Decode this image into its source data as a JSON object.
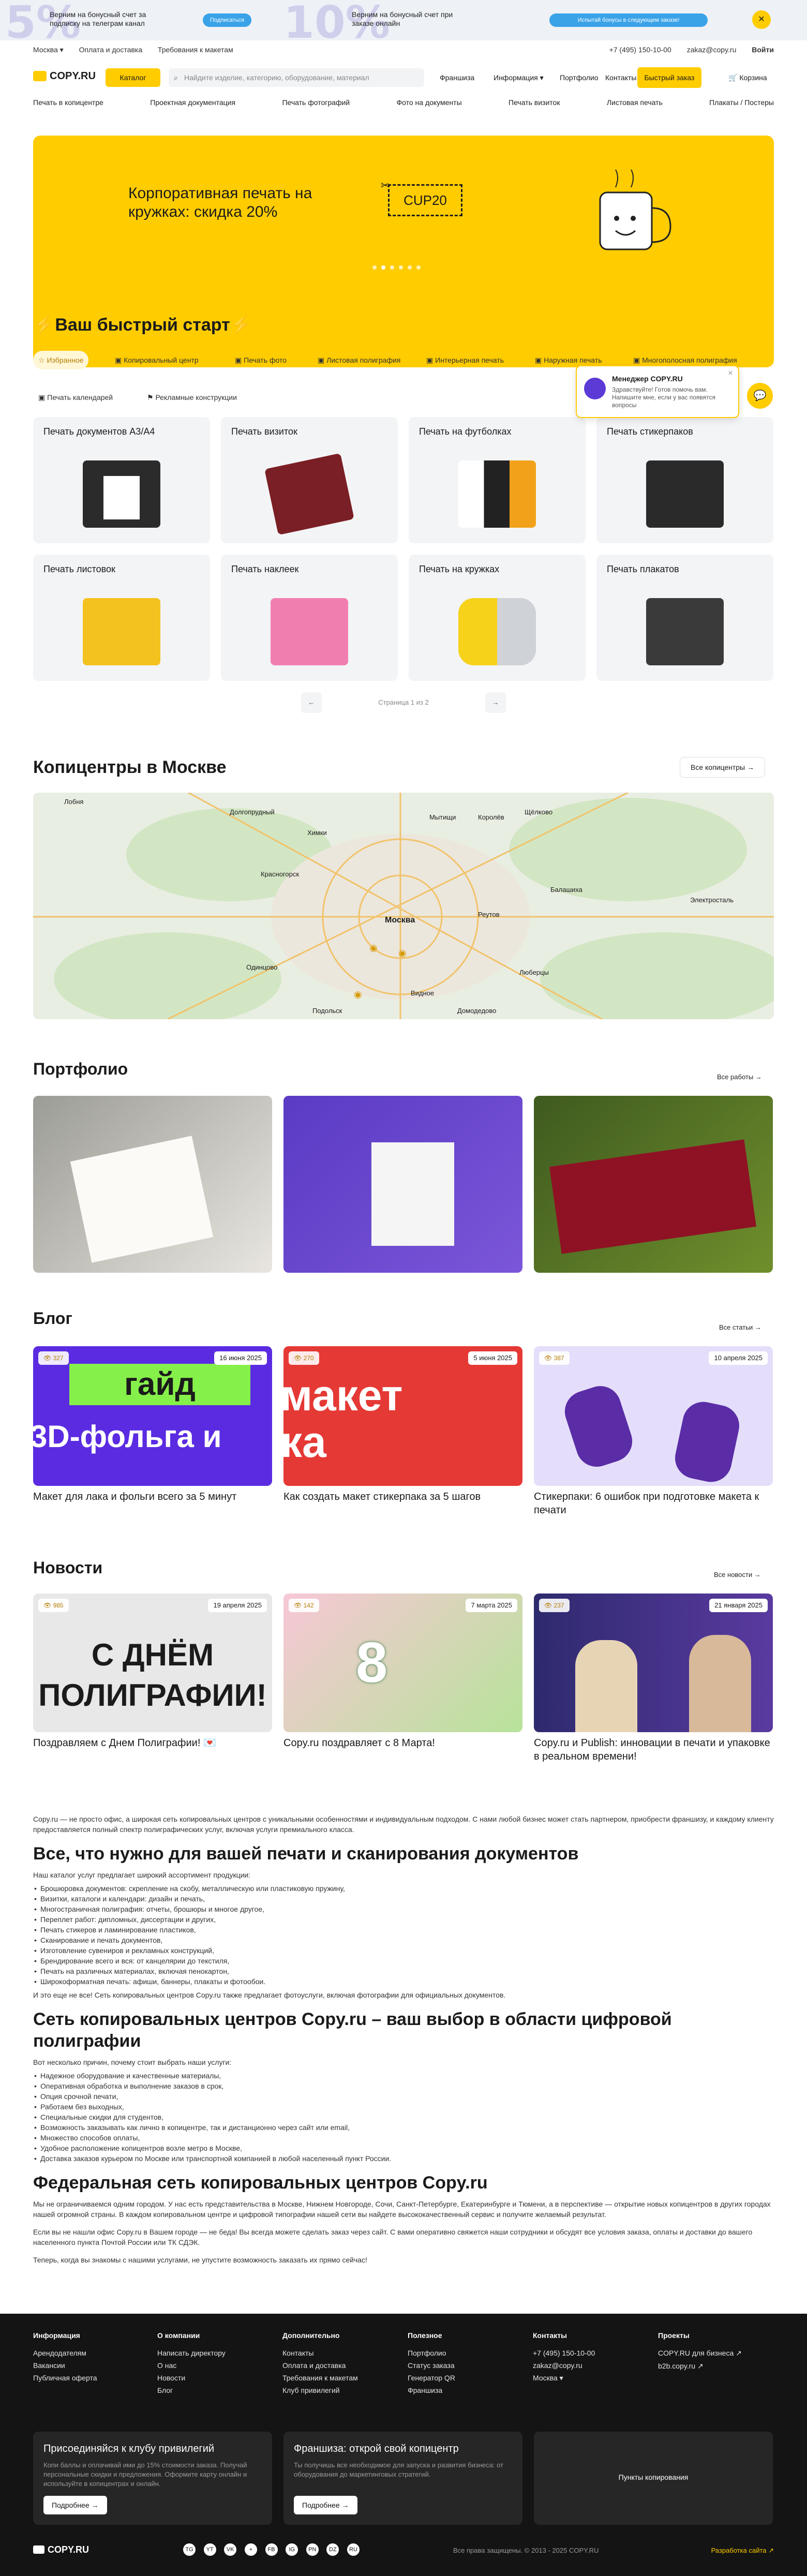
{
  "promo": {
    "left_text": "Верним на бонусный счет за подписку на телеграм канал",
    "left_button": "Подписаться",
    "right_text": "Верним на бонусный счет при заказе онлайн",
    "right_button": "Испытай бонусы в следующем заказе!",
    "num_left": "5%",
    "num_right": "10%",
    "close": "✕"
  },
  "topbar": {
    "city": "Москва ▾",
    "delivery": "Оплата и доставка",
    "requirements": "Требования к макетам",
    "phone": "+7 (495) 150-10-00",
    "email": "zakaz@copy.ru",
    "login": "Войти"
  },
  "header": {
    "logo": "COPY.RU",
    "catalog": "Каталог",
    "search_placeholder": "Найдите изделие, категорию, оборудование, материал",
    "nav": [
      "Франшиза",
      "Информация ▾",
      "Портфолио",
      "Контакты"
    ],
    "fast_order": "Быстрый заказ",
    "cart": "Корзина"
  },
  "categories": [
    "Печать в копицентре",
    "Проектная документация",
    "Печать фотографий",
    "Фото на документы",
    "Печать визиток",
    "Листовая печать",
    "Плакаты / Постеры"
  ],
  "banner": {
    "title": "Корпоративная печать на кружках: скидка 20%",
    "coupon": "CUP20"
  },
  "quickstart": {
    "title": "⚡Ваш быстрый старт⚡",
    "tabs": [
      "Избранное",
      "Копировальный центр",
      "Печать фото",
      "Листовая полиграфия",
      "Интерьерная печать",
      "Наружная печать",
      "Многополосная полиграфия",
      "Печать календарей",
      "Рекламные конструкции"
    ],
    "cards": [
      "Печать документов А3/А4",
      "Печать визиток",
      "Печать на футболках",
      "Печать стикерпаков",
      "Печать листовок",
      "Печать наклеек",
      "Печать на кружках",
      "Печать плакатов"
    ],
    "pager": "Страница 1 из 2"
  },
  "chat": {
    "name": "Менеджер COPY.RU",
    "text": "Здравствуйте! Готов помочь вам. Напишите мне, если у вас появятся вопросы"
  },
  "copycenters": {
    "title": "Копицентры в Москве",
    "button": "Все копицентры",
    "map_labels": [
      "Лобня",
      "Долгопрудный",
      "Химки",
      "Мытищи",
      "Королёв",
      "Щёлково",
      "Красногорск",
      "Балашиха",
      "Москва",
      "Реутов",
      "Одинцово",
      "Люберцы",
      "Видное",
      "Домодедово",
      "Подольск",
      "Электросталь"
    ]
  },
  "portfolio": {
    "title": "Портфолио",
    "link": "Все работы"
  },
  "blog": {
    "title": "Блог",
    "link": "Все статьи",
    "items": [
      {
        "views": "327",
        "date": "16 июня 2025",
        "caption": "Макет для лака и фольги всего за 5 минут"
      },
      {
        "views": "270",
        "date": "5 июня 2025",
        "caption": "Как создать макет стикерпака за 5 шагов"
      },
      {
        "views": "387",
        "date": "10 апреля 2025",
        "caption": "Стикерпаки: 6 ошибок при подготовке макета к печати"
      }
    ]
  },
  "news": {
    "title": "Новости",
    "link": "Все новости",
    "items": [
      {
        "views": "985",
        "date": "19 апреля 2025",
        "caption": "Поздравляем с Днем Полиграфии! 💌"
      },
      {
        "views": "142",
        "date": "7 марта 2025",
        "caption": "Copy.ru поздравляет с 8 Марта!"
      },
      {
        "views": "237",
        "date": "21 января 2025",
        "caption": "Copy.ru и Publish: инновации в печати и упаковке в реальном времени!"
      }
    ]
  },
  "seo": {
    "intro": "Copy.ru — не просто офис, а широкая сеть копировальных центров с уникальными особенностями и индивидуальным подходом. С нами любой бизнес может стать партнером, приобрести франшизу, и каждому клиенту предоставляется полный спектр полиграфических услуг, включая услуги премиального класса.",
    "h1": "Все, что нужно для вашей печати и сканирования документов",
    "p1": "Наш каталог услуг предлагает широкий ассортимент продукции:",
    "list1": [
      "Брошюровка документов: скрепление на скобу, металлическую или пластиковую пружину,",
      "Визитки, каталоги и календари: дизайн и печать,",
      "Многостраничная полиграфия: отчеты, брошюры и многое другое,",
      "Переплет работ: дипломных, диссертации и других,",
      "Печать стикеров и ламинирование пластиков,",
      "Сканирование и печать документов,",
      "Изготовление сувениров и рекламных конструкций,",
      "Брендирование всего и вся: от канцелярии до текстиля,",
      "Печать на различных материалах, включая пенокартон,",
      "Широкоформатная печать: афиши, баннеры, плакаты и фотообои."
    ],
    "p2": "И это еще не все! Сеть копировальных центров Copy.ru также предлагает фотоуслуги, включая фотографии для официальных документов.",
    "h2": "Сеть копировальных центров Copy.ru – ваш выбор в области цифровой полиграфии",
    "p3": "Вот несколько причин, почему стоит выбрать наши услуги:",
    "list2": [
      "Надежное оборудование и качественные материалы,",
      "Оперативная обработка и выполнение заказов в срок,",
      "Опция срочной печати,",
      "Работаем без выходных,",
      "Специальные скидки для студентов,",
      "Возможность заказывать как лично в копицентре, так и дистанционно через сайт или email,",
      "Множество способов оплаты,",
      "Удобное расположение копицентров возле метро в Москве,",
      "Доставка заказов курьером по Москве или транспортной компанией в любой населенный пункт России."
    ],
    "h3": "Федеральная сеть копировальных центров Copy.ru",
    "p4": "Мы не ограничиваемся одним городом. У нас есть представительства в Москве, Нижнем Новгороде, Сочи, Санкт-Петербурге, Екатеринбурге и Тюмени, а в перспективе — открытие новых копицентров в других городах нашей огромной страны. В каждом копировальном центре и цифровой типографии нашей сети вы найдете высококачественный сервис и получите желаемый результат.",
    "p5": "Если вы не нашли офис Copy.ru в Вашем городе — не беда! Вы всегда можете сделать заказ через сайт. С вами оперативно свяжется наши сотрудники и обсудят все условия заказа, оплаты и доставки до вашего населенного пункта Почтой России или ТК СДЭК.",
    "p6": "Теперь, когда вы знакомы с нашими услугами, не упустите возможность заказать их прямо сейчас!"
  },
  "footer": {
    "cols": [
      {
        "h": "Информация",
        "items": [
          "Арендодателям",
          "Вакансии",
          "Публичная оферта"
        ]
      },
      {
        "h": "О компании",
        "items": [
          "Написать директору",
          "О нас",
          "Новости",
          "Блог"
        ]
      },
      {
        "h": "Дополнительно",
        "items": [
          "Контакты",
          "Оплата и доставка",
          "Требования к макетам",
          "Клуб привилегий"
        ]
      },
      {
        "h": "Полезное",
        "items": [
          "Портфолио",
          "Статус заказа",
          "Генератор QR",
          "Франшиза"
        ]
      },
      {
        "h": "Контакты",
        "items": [
          "+7 (495) 150-10-00",
          "zakaz@copy.ru",
          "Москва ▾"
        ]
      },
      {
        "h": "Проекты",
        "items": [
          "COPY.RU для бизнеса ↗",
          "b2b.copy.ru ↗"
        ]
      }
    ],
    "club_title": "Присоединяйся к клубу привилегий",
    "club_text": "Копи баллы и оплачивай ими до 15% стоимости заказа. Получай персональные скидки и предложения. Оформите карту онлайн и используйте в копицентрах и онлайн.",
    "club_btn": "Подробнее →",
    "franchise_title": "Франшиза: открой свой копицентр",
    "franchise_text": "Ты получишь все необходимое для запуска и развития бизнеса: от оборудования до маркетинговых стратегий.",
    "franchise_btn": "Подробнее →",
    "points_btn": "Пункты копирования",
    "rights": "Все права защищены. © 2013 - 2025 COPY.RU",
    "dev": "Разработка сайта ↗",
    "social": [
      "TG",
      "YT",
      "VK",
      "+",
      "FB",
      "IG",
      "PN",
      "DZ",
      "RU"
    ]
  }
}
